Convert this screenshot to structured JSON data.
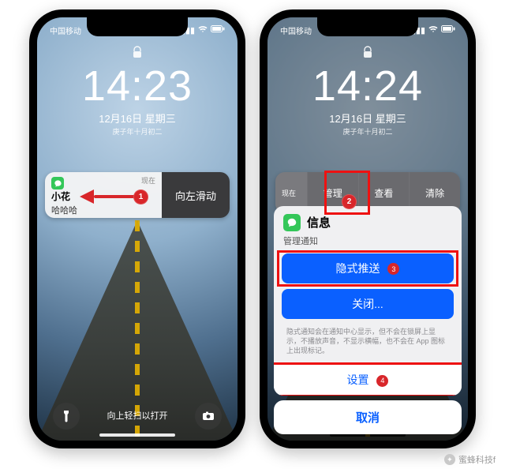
{
  "left": {
    "status": {
      "carrier": "中国移动",
      "signal": "▮▮▮▮",
      "wifi": "⌄",
      "battery": "▢"
    },
    "lock": {
      "time": "14:23",
      "date": "12月16日 星期三",
      "date_sub": "庚子年十月初二"
    },
    "notification": {
      "time_label": "现在",
      "app_name": "信息",
      "title": "小花",
      "body": "哈哈哈",
      "swipe_action": "向左滑动"
    },
    "swipe_hint": "向上轻扫以打开",
    "markers": {
      "1": "1"
    }
  },
  "right": {
    "status": {
      "carrier": "中国移动",
      "signal": "▮▮▮▮",
      "wifi": "⌄",
      "battery": "▢"
    },
    "lock": {
      "time": "14:24",
      "date": "12月16日 星期三",
      "date_sub": "庚子年十月初二"
    },
    "actions_row": {
      "time_label": "现在",
      "manage": "管理",
      "view": "查看",
      "clear": "清除"
    },
    "sheet": {
      "app_name": "信息",
      "subtitle": "管理通知",
      "deliver_quietly": "隐式推送",
      "turn_off": "关闭...",
      "note": "隐式通知会在通知中心显示，但不会在锁屏上显示，不播放声音，不显示横幅，也不会在 App 图标上出现标记。",
      "settings": "设置",
      "cancel": "取消"
    },
    "markers": {
      "2": "2",
      "3": "3",
      "4": "4"
    }
  },
  "watermark": "蜜蜂科技f"
}
